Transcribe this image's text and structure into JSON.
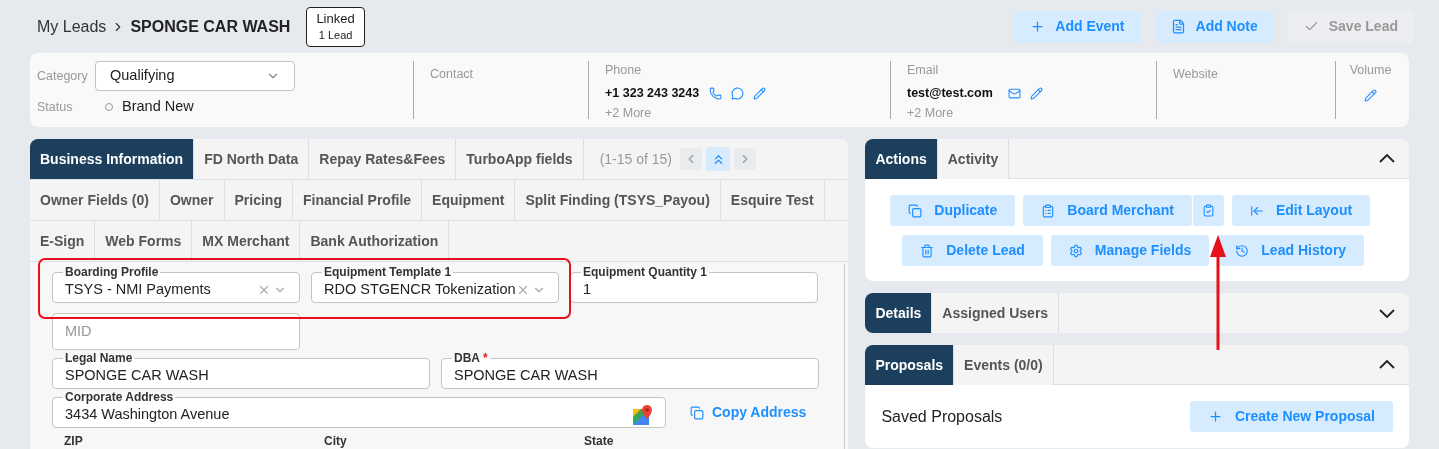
{
  "breadcrumb": {
    "parent": "My Leads",
    "title": "SPONGE CAR WASH"
  },
  "linked_badge": {
    "title": "Linked",
    "subtitle": "1 Lead"
  },
  "header_buttons": [
    {
      "label": "Add Event",
      "disabled": false
    },
    {
      "label": "Add Note",
      "disabled": false
    },
    {
      "label": "Save Lead",
      "disabled": true
    }
  ],
  "info": {
    "category": {
      "label": "Category",
      "value": "Qualifying"
    },
    "status": {
      "label": "Status",
      "value": "Brand New"
    },
    "contact": {
      "label": "Contact"
    },
    "phone": {
      "label": "Phone",
      "value": "+1 323 243 3243",
      "more": "+2 More"
    },
    "email": {
      "label": "Email",
      "value": "test@test.com",
      "more": "+2 More"
    },
    "website": {
      "label": "Website"
    },
    "volume": {
      "label": "Volume"
    }
  },
  "tab_rows": [
    [
      {
        "label": "Business Information",
        "selected": true
      },
      {
        "label": "FD North Data",
        "selected": false
      },
      {
        "label": "Repay Rates&Fees",
        "selected": false
      },
      {
        "label": "TurboApp fields",
        "selected": false
      }
    ],
    [
      {
        "label": "Owner Fields (0)",
        "selected": false
      },
      {
        "label": "Owner",
        "selected": false
      },
      {
        "label": "Pricing",
        "selected": false
      },
      {
        "label": "Financial Profile",
        "selected": false
      },
      {
        "label": "Equipment",
        "selected": false
      },
      {
        "label": "Split Finding (TSYS_Payou)",
        "selected": false
      },
      {
        "label": "Esquire Test",
        "selected": false
      }
    ],
    [
      {
        "label": "E-Sign",
        "selected": false
      },
      {
        "label": "Web Forms",
        "selected": false
      },
      {
        "label": "MX Merchant",
        "selected": false
      },
      {
        "label": "Bank Authorization",
        "selected": false
      }
    ]
  ],
  "pager": "(1-15 of 15)",
  "form_rows": [
    [
      {
        "kind": "select",
        "label": "Boarding Profile",
        "value": "TSYS - NMI Payments"
      },
      {
        "kind": "select",
        "label": "Equipment Template 1",
        "value": "RDO STGENCR Tokenization"
      },
      {
        "kind": "text",
        "label": "Equipment Quantity 1",
        "value": "1"
      }
    ],
    [
      {
        "kind": "text",
        "placeholder": "MID"
      }
    ],
    [
      {
        "kind": "text",
        "label": "Legal Name",
        "value": "SPONGE CAR WASH"
      },
      {
        "kind": "text",
        "label": "DBA",
        "required_mark": "*",
        "value": "SPONGE CAR WASH"
      }
    ],
    [
      {
        "kind": "address",
        "label": "Corporate Address",
        "value": "3434 Washington Avenue"
      }
    ]
  ],
  "copy_address": "Copy Address",
  "bottom_labels": [
    "ZIP",
    "City",
    "State"
  ],
  "panels": [
    {
      "tabs": [
        {
          "label": "Actions",
          "selected": true
        },
        {
          "label": "Activity",
          "selected": false
        }
      ],
      "expanded": true,
      "kind": "actions",
      "button_rows": [
        [
          {
            "label": "Duplicate",
            "split": false
          },
          {
            "label": "Board Merchant",
            "split": true
          },
          {
            "label": "Edit Layout",
            "split": false
          }
        ],
        [
          {
            "label": "Delete Lead",
            "split": false
          },
          {
            "label": "Manage Fields",
            "split": false
          },
          {
            "label": "Lead History",
            "split": false
          }
        ]
      ]
    },
    {
      "tabs": [
        {
          "label": "Details",
          "selected": true
        },
        {
          "label": "Assigned Users",
          "selected": false
        }
      ],
      "expanded": false
    },
    {
      "tabs": [
        {
          "label": "Proposals",
          "selected": true
        },
        {
          "label": "Events (0/0)",
          "selected": false
        }
      ],
      "expanded": true,
      "kind": "proposals",
      "heading": "Saved Proposals",
      "button": "Create New Proposal"
    }
  ]
}
